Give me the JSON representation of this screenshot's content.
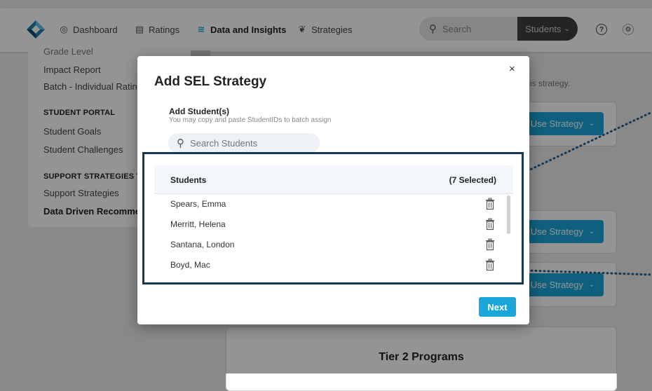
{
  "nav": {
    "items": [
      {
        "label": "Dashboard",
        "icon": "dashboard-icon"
      },
      {
        "label": "Ratings",
        "icon": "ratings-icon"
      },
      {
        "label": "Data and Insights",
        "icon": "insights-icon"
      },
      {
        "label": "Strategies",
        "icon": "strategies-icon"
      }
    ],
    "search_placeholder": "Search",
    "scope_selector": "Students"
  },
  "sidebar": {
    "partial_item": "Grade Level",
    "items_top": [
      "Impact Report",
      "Batch - Individual Ratin"
    ],
    "student_portal_header": "STUDENT PORTAL",
    "student_portal_items": [
      "Student Goals",
      "Student Challenges"
    ],
    "support_header": "SUPPORT STRATEGIES TR",
    "support_items": [
      "Support Strategies",
      "Data Driven Recommen"
    ]
  },
  "main": {
    "hint_text": "is strategy.",
    "use_strategy_label": "Use Strategy",
    "tier_title": "Tier 2 Programs"
  },
  "modal": {
    "title": "Add SEL Strategy",
    "close": "×",
    "add_label": "Add Student(s)",
    "add_hint": "You may copy and paste StudentIDs to batch assign",
    "search_placeholder": "Search Students",
    "table_header": "Students",
    "selected_count": "(7 Selected)",
    "students": [
      "Spears, Emma",
      "Merritt, Helena",
      "Santana, London",
      "Boyd, Mac"
    ],
    "next_label": "Next"
  },
  "colors": {
    "accent": "#1aa6d9",
    "highlight_border": "#163852",
    "topbar_dark": "#3f3f3f"
  }
}
